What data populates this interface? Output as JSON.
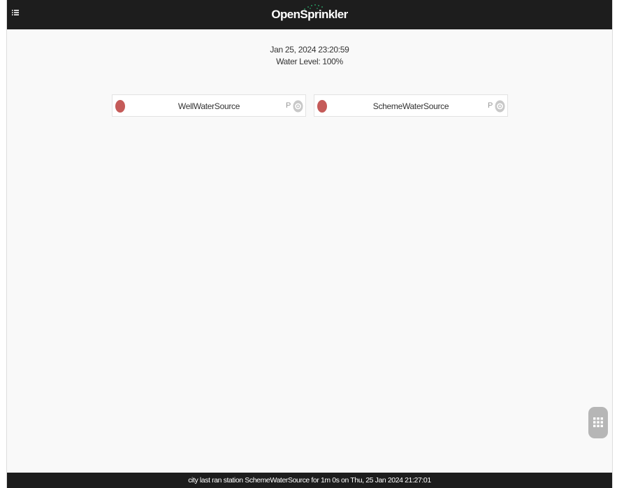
{
  "header": {
    "app_name": "OpenSprinkler",
    "menu_icon": "list-menu-icon"
  },
  "status": {
    "datetime": "Jan 25, 2024 23:20:59",
    "water_level": "Water Level: 100%"
  },
  "stations": [
    {
      "name": "WellWaterSource",
      "state_color": "#c55b59",
      "flag": "P",
      "settings_icon": "gear-icon"
    },
    {
      "name": "SchemeWaterSource",
      "state_color": "#c55b59",
      "flag": "P",
      "settings_icon": "gear-icon"
    }
  ],
  "fab": {
    "icon": "grid-icon"
  },
  "footer": {
    "message": "city last ran station SchemeWaterSource for 1m 0s on Thu, 25 Jan 2024 21:27:01"
  },
  "colors": {
    "header_bg": "#1d1d1d",
    "background": "#f9f9f9",
    "station_off": "#c55b59"
  }
}
